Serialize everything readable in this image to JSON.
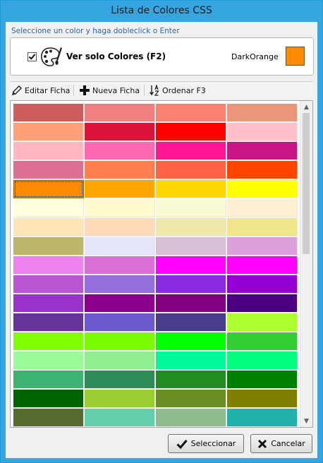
{
  "window": {
    "title": "Lista de Colores CSS"
  },
  "hint": "Seleccione un color y haga dobleclick o Enter",
  "filter": {
    "checkbox_label": "Ver solo Colores (F2)",
    "checked": true
  },
  "selected": {
    "name": "DarkOrange",
    "color": "#ff8c00"
  },
  "toolbar": {
    "edit_label": "Editar Ficha",
    "new_label": "Nueva Ficha",
    "sort_label": "Ordenar F3"
  },
  "grid": {
    "selected_index": 16,
    "colors": [
      "#cd5c5c",
      "#f08080",
      "#fa8072",
      "#e9967a",
      "#ffa07a",
      "#dc143c",
      "#ff0000",
      "#ffc0cb",
      "#ffb6c1",
      "#ff69b4",
      "#ff1493",
      "#c71585",
      "#db7093",
      "#ff7f50",
      "#ff6347",
      "#ff4500",
      "#ff8c00",
      "#ffa500",
      "#ffd700",
      "#ffff00",
      "#ffffe0",
      "#fffacd",
      "#fafad2",
      "#ffefd5",
      "#ffe4b5",
      "#ffdab9",
      "#eee8aa",
      "#f0e68c",
      "#bdb76b",
      "#e6e6fa",
      "#d8bfd8",
      "#dda0dd",
      "#ee82ee",
      "#da70d6",
      "#ff00ff",
      "#ff00ff",
      "#ba55d3",
      "#9370db",
      "#8a2be2",
      "#9400d3",
      "#9932cc",
      "#8b008b",
      "#800080",
      "#4b0082",
      "#663399",
      "#6a5acd",
      "#483d8b",
      "#adff2f",
      "#7fff00",
      "#7cfc00",
      "#00ff00",
      "#32cd32",
      "#98fb98",
      "#90ee90",
      "#00fa9a",
      "#00ff7f",
      "#3cb371",
      "#2e8b57",
      "#228b22",
      "#008000",
      "#006400",
      "#9acd32",
      "#6b8e23",
      "#808000",
      "#556b2f",
      "#66cdaa",
      "#8fbc8f",
      "#20b2aa"
    ]
  },
  "buttons": {
    "select_label": "Seleccionar",
    "cancel_label": "Cancelar"
  }
}
